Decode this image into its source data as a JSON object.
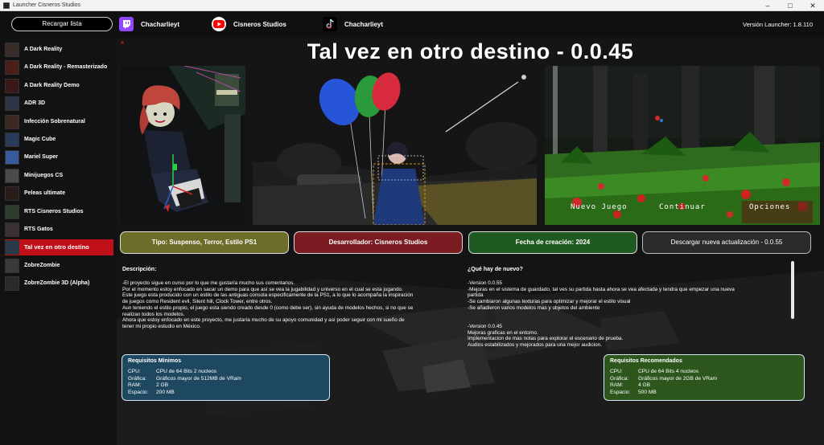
{
  "window": {
    "title": "Launcher Cisneros Studios"
  },
  "header": {
    "reload_label": "Recargar lista",
    "twitch": "Chacharlieyt",
    "youtube": "Cisneros Studios",
    "tiktok": "Chacharlieyt",
    "version": "Versión Launcher: 1.8.110"
  },
  "sidebar": {
    "items": [
      {
        "label": "A Dark Reality"
      },
      {
        "label": "A Dark Reality - Remasterizado"
      },
      {
        "label": "A Dark Reality Demo"
      },
      {
        "label": "ADR 3D"
      },
      {
        "label": "Infección Sobrenatural"
      },
      {
        "label": "Magic Cube"
      },
      {
        "label": "Mariel Super"
      },
      {
        "label": "Minijuegos CS"
      },
      {
        "label": "Peleas ultimate"
      },
      {
        "label": "RTS Cisneros Studios"
      },
      {
        "label": "RTS Gatos"
      },
      {
        "label": "Tal vez en otro destino"
      },
      {
        "label": "ZobreZombie"
      },
      {
        "label": "ZobreZombie 3D (Alpha)"
      }
    ],
    "selected_index": 11
  },
  "main": {
    "close_mark": "x",
    "title": "Tal vez en otro destino - 0.0.45",
    "screenshot_menu": {
      "new_game": "Nuevo Juego",
      "continue": "Continuar",
      "options": "Opciones"
    },
    "tags": {
      "type": "Tipo: Suspenso, Terror, Estilo PS1",
      "developer": "Desarrollador: Cisneros Studios",
      "date": "Fecha de creación: 2024",
      "download": "Descargar nueva actualización - 0.0.55"
    },
    "description_label": "Descripción:",
    "description": [
      "-El proyecto sigue en curso por lo que me gustaría mucho sus comentarios.",
      "Por el momento estoy enfocado en sacar un demo para que así se vea la jugabilidad y universo en el cual se esta jugando.",
      "Este juego esta producido con un estilo de las antiguas consola especificamente de la PS1, a lo que lo acompaña la inspiración",
      "de juegos como Resident evil, Silent hill, Clock Tower, entre otros.",
      "Aun teniendo el estilo propio, el juego esta siendo creado desde 0 (como debe ser), sin ayuda de modelos hechos, si no que se",
      "realizan todos los modelos.",
      "Ahora que estoy enfocado en este proyecto, me justaría mucho de su apoyo comunidad y así poder seguir con mi sueño de",
      "tener mi propio estudio en México."
    ],
    "whatsnew_label": "¿Qué hay de nuevo?",
    "whatsnew": [
      "-Version 0.0.55",
      "-Mejoras en el sistema de guardado, tal ves su partida hasta ahora se vea afectada y tendra que empezar una nueva",
      "partida",
      "-Se cambiaron algunas texturas para optimizar y mejorar el estilo visual",
      "-Se añadieron varios modelos mas y objetos del ambiente",
      "",
      "",
      "-Version 0.0.45",
      "Mejoras graficas en el entorno.",
      "Implementacion de mas notas para explorar el escenario de prueba.",
      "Audios estabilizados y mejorados para una mejor audicion."
    ],
    "min_req": {
      "title": "Requisitos Minimos",
      "rows": [
        {
          "k": "CPU:",
          "v": "CPU de 64 Bits 2 nucleos"
        },
        {
          "k": "Gráfica:",
          "v": "Gráficos mayor de 512MB de VRam"
        },
        {
          "k": "RAM:",
          "v": "2 GB"
        },
        {
          "k": "Espacio:",
          "v": "200 MB"
        }
      ]
    },
    "rec_req": {
      "title": "Requisitos Recomendados",
      "rows": [
        {
          "k": "CPU:",
          "v": "CPU de 64 Bits 4 nucleos"
        },
        {
          "k": "Gráfica:",
          "v": "Gráficos mayor de 2GB de VRam"
        },
        {
          "k": "RAM:",
          "v": "4 GB"
        },
        {
          "k": "Espacio:",
          "v": "500 MB"
        }
      ]
    }
  },
  "colors": {
    "selected": "#c0111b",
    "tag_type": "#6d6d2a",
    "tag_dev": "#7a1c22",
    "tag_date": "#1e5a20",
    "min_req_bg": "#1e4860",
    "rec_req_bg": "#2c561c"
  }
}
